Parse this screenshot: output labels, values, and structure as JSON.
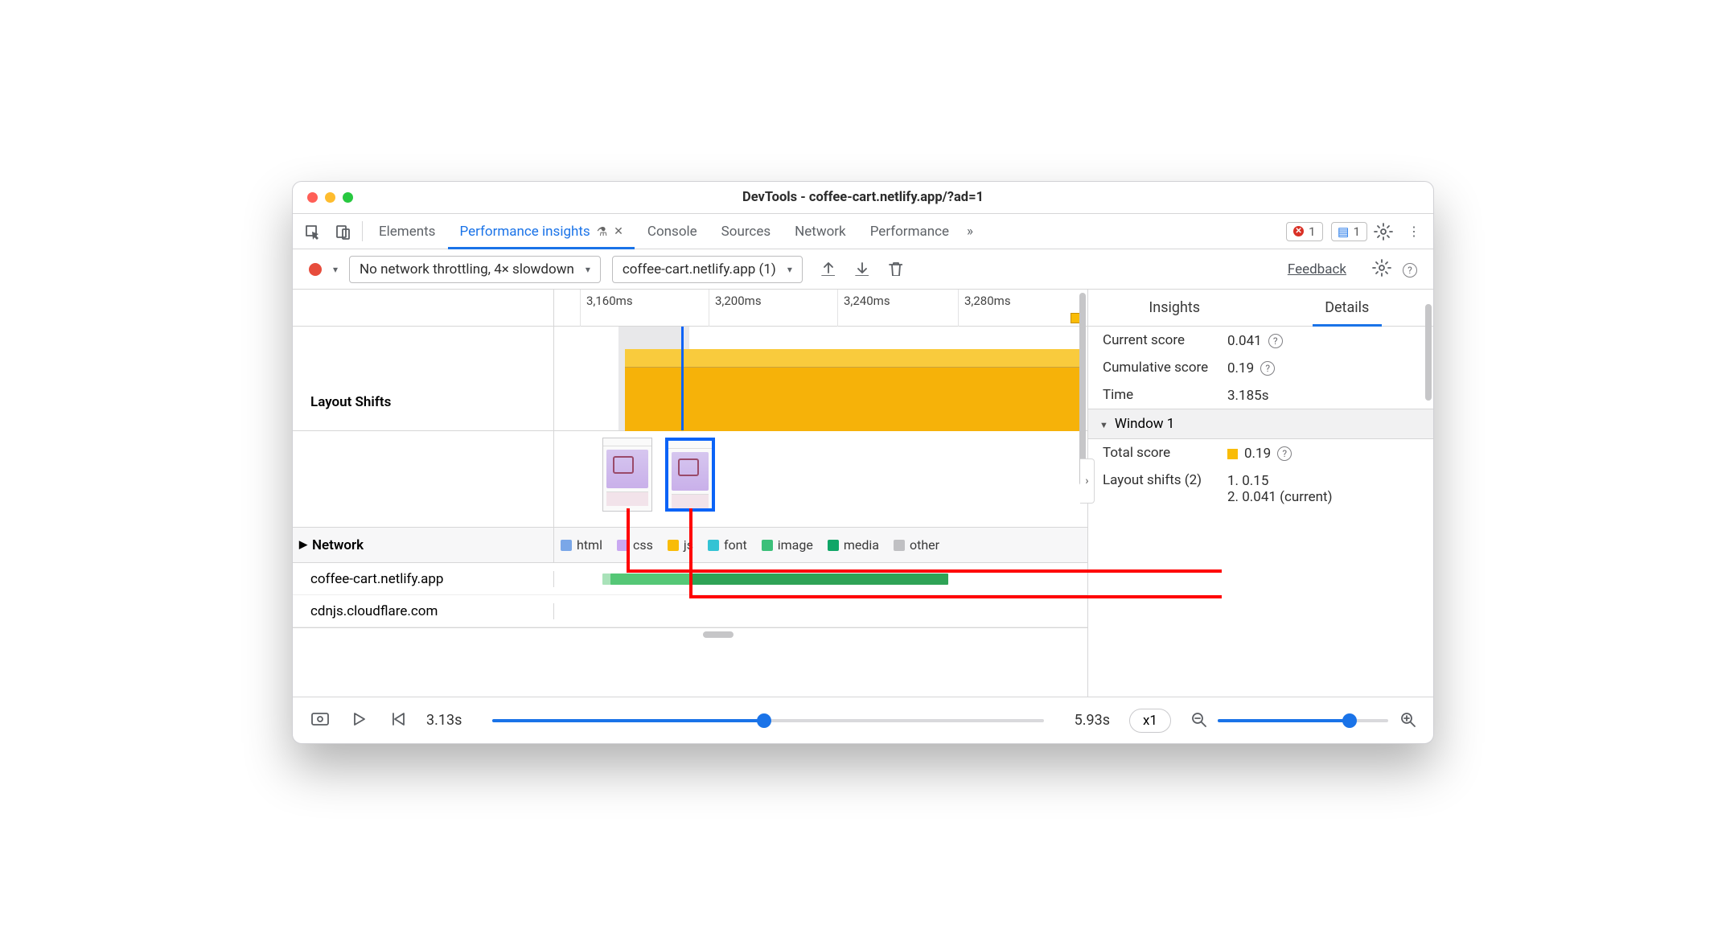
{
  "window": {
    "title": "DevTools - coffee-cart.netlify.app/?ad=1"
  },
  "tabs": {
    "elements": "Elements",
    "perf_insights": "Performance insights",
    "console": "Console",
    "sources": "Sources",
    "network": "Network",
    "performance": "Performance"
  },
  "badges": {
    "errors": "1",
    "messages": "1",
    "more": "»"
  },
  "toolbar": {
    "throttling": "No network throttling, 4× slowdown",
    "page_select": "coffee-cart.netlify.app (1)",
    "feedback": "Feedback"
  },
  "ruler": {
    "t1": "3,160ms",
    "t2": "3,200ms",
    "t3": "3,240ms",
    "t4": "3,280ms"
  },
  "tracks": {
    "layout_shifts": "Layout Shifts",
    "network": "Network",
    "legend": {
      "html": "html",
      "css": "css",
      "js": "js",
      "font": "font",
      "image": "image",
      "media": "media",
      "other": "other"
    }
  },
  "network_rows": {
    "r1": "coffee-cart.netlify.app",
    "r2": "cdnjs.cloudflare.com"
  },
  "footer": {
    "start": "3.13s",
    "end": "5.93s",
    "speed": "x1"
  },
  "right": {
    "tab_insights": "Insights",
    "tab_details": "Details",
    "current_score_label": "Current score",
    "current_score": "0.041",
    "cum_score_label": "Cumulative score",
    "cum_score": "0.19",
    "time_label": "Time",
    "time": "3.185s",
    "window": "Window 1",
    "total_label": "Total score",
    "total": "0.19",
    "ls_label": "Layout shifts (2)",
    "ls1": "1. 0.15",
    "ls2": "2. 0.041 (current)"
  },
  "network_tri": "▶"
}
